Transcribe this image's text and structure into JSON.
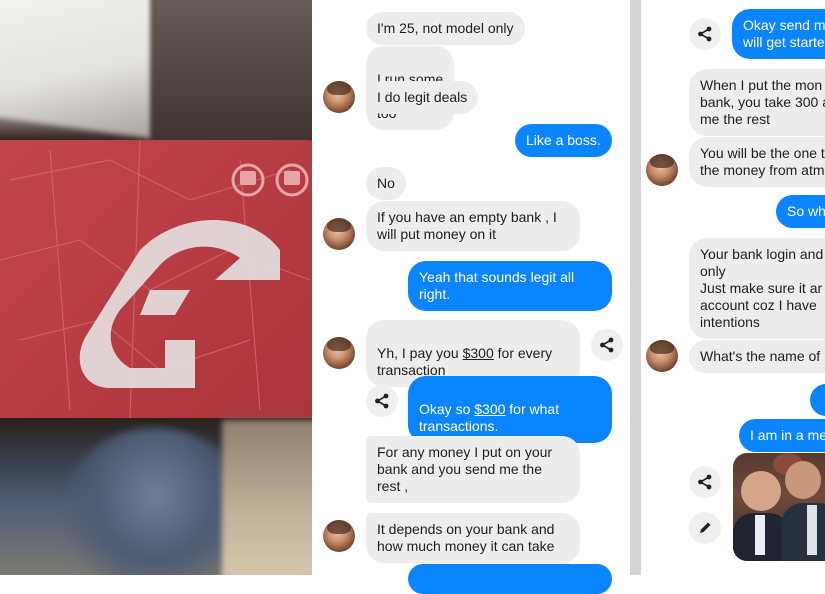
{
  "chat_middle": {
    "messages": [
      {
        "text": "I'm 25, not model only"
      },
      {
        "pre": "I run some",
        "post": "too"
      },
      {
        "text": "I do legit deals"
      },
      {
        "text": "Like a boss."
      },
      {
        "text": "No"
      },
      {
        "text": "If you have an empty bank , I\nwill put money on it"
      },
      {
        "text": "Yeah that sounds legit all\nright."
      },
      {
        "pre": "Yh, I pay you ",
        "link": "$300",
        "post": " for every\ntransaction"
      },
      {
        "pre": "Okay so ",
        "link": "$300",
        "post": " for what\ntransactions."
      },
      {
        "text": "For any money I put on your\nbank and you send me the\nrest ,"
      },
      {
        "text": "It depends on your bank and\nhow much money it can take"
      }
    ]
  },
  "chat_right": {
    "messages": [
      {
        "text": "Okay send m\nwill get starte"
      },
      {
        "text": "When I put the mon\nbank, you take 300 a\nme the rest"
      },
      {
        "text": "You will be the one t\nthe money from atm"
      },
      {
        "text": "So wh"
      },
      {
        "text": "Your bank login and\nonly\nJust make sure it ar\naccount coz I have\nintentions"
      },
      {
        "text": "What's the name of"
      },
      {
        "text": "I am in a me"
      }
    ]
  },
  "icons": {
    "share": "share-icon",
    "edit": "pencil-icon",
    "avatar": "contact-avatar"
  },
  "colors": {
    "outgoing_bubble": "#0a84ff",
    "incoming_bubble": "#ededed",
    "card_red": "#b83c43"
  }
}
